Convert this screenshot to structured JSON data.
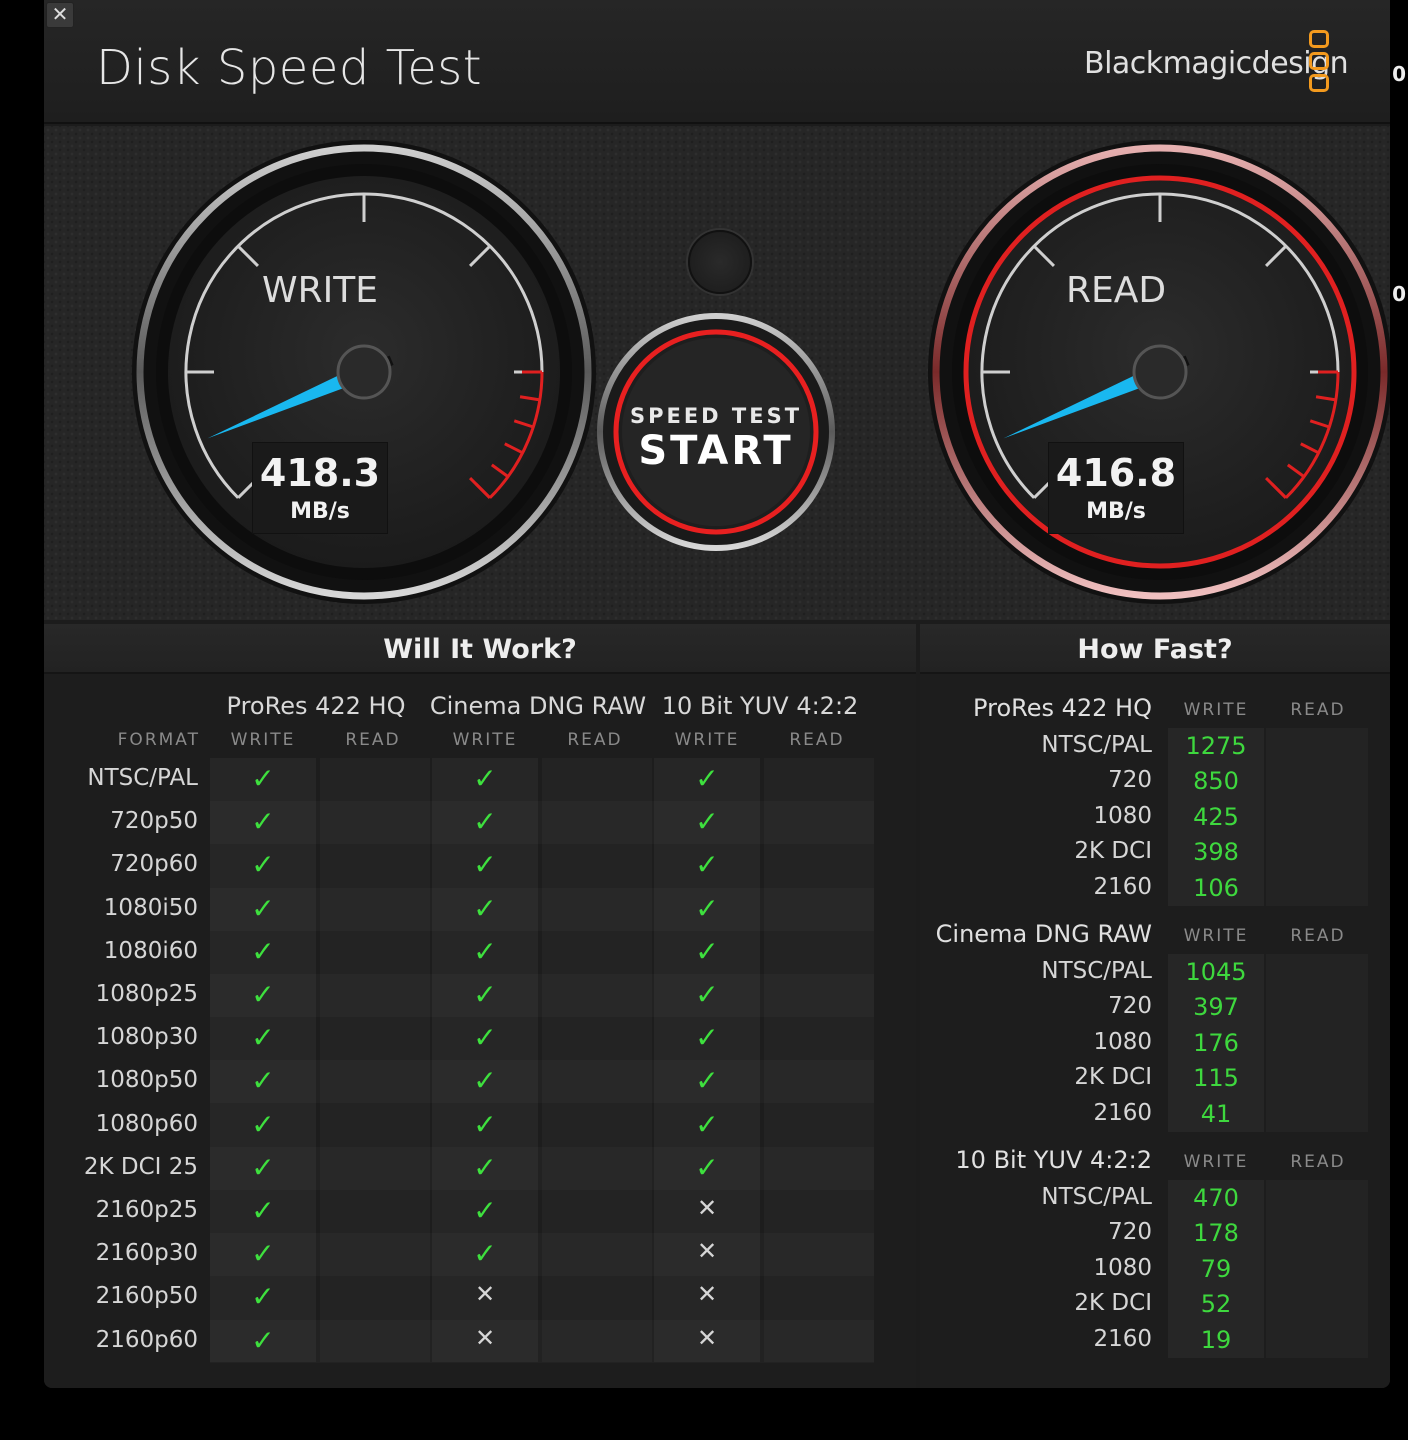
{
  "app": {
    "title": "Disk Speed Test",
    "brand": "Blackmagicdesign",
    "close": "✕",
    "edge_marks": [
      "0",
      "0"
    ]
  },
  "gauges": {
    "write": {
      "label": "WRITE",
      "value": "418.3",
      "unit": "MB/s"
    },
    "read": {
      "label": "READ",
      "value": "416.8",
      "unit": "MB/s"
    }
  },
  "start_button": {
    "sub": "SPEED TEST",
    "main": "START"
  },
  "will_it_work": {
    "title": "Will It Work?",
    "format_header": "FORMAT",
    "codecs": [
      "ProRes 422 HQ",
      "Cinema DNG RAW",
      "10 Bit YUV 4:2:2"
    ],
    "col_write": "WRITE",
    "col_read": "READ",
    "rows": [
      {
        "format": "NTSC/PAL",
        "marks": [
          "ok",
          "ok",
          "ok"
        ]
      },
      {
        "format": "720p50",
        "marks": [
          "ok",
          "ok",
          "ok"
        ]
      },
      {
        "format": "720p60",
        "marks": [
          "ok",
          "ok",
          "ok"
        ]
      },
      {
        "format": "1080i50",
        "marks": [
          "ok",
          "ok",
          "ok"
        ]
      },
      {
        "format": "1080i60",
        "marks": [
          "ok",
          "ok",
          "ok"
        ]
      },
      {
        "format": "1080p25",
        "marks": [
          "ok",
          "ok",
          "ok"
        ]
      },
      {
        "format": "1080p30",
        "marks": [
          "ok",
          "ok",
          "ok"
        ]
      },
      {
        "format": "1080p50",
        "marks": [
          "ok",
          "ok",
          "ok"
        ]
      },
      {
        "format": "1080p60",
        "marks": [
          "ok",
          "ok",
          "ok"
        ]
      },
      {
        "format": "2K DCI 25",
        "marks": [
          "ok",
          "ok",
          "ok"
        ]
      },
      {
        "format": "2160p25",
        "marks": [
          "ok",
          "ok",
          "no"
        ]
      },
      {
        "format": "2160p30",
        "marks": [
          "ok",
          "ok",
          "no"
        ]
      },
      {
        "format": "2160p50",
        "marks": [
          "ok",
          "no",
          "no"
        ]
      },
      {
        "format": "2160p60",
        "marks": [
          "ok",
          "no",
          "no"
        ]
      }
    ]
  },
  "how_fast": {
    "title": "How Fast?",
    "col_write": "WRITE",
    "col_read": "READ",
    "groups": [
      {
        "codec": "ProRes 422 HQ",
        "rows": [
          {
            "format": "NTSC/PAL",
            "write": "1275"
          },
          {
            "format": "720",
            "write": "850"
          },
          {
            "format": "1080",
            "write": "425"
          },
          {
            "format": "2K DCI",
            "write": "398"
          },
          {
            "format": "2160",
            "write": "106"
          }
        ]
      },
      {
        "codec": "Cinema DNG RAW",
        "rows": [
          {
            "format": "NTSC/PAL",
            "write": "1045"
          },
          {
            "format": "720",
            "write": "397"
          },
          {
            "format": "1080",
            "write": "176"
          },
          {
            "format": "2K DCI",
            "write": "115"
          },
          {
            "format": "2160",
            "write": "41"
          }
        ]
      },
      {
        "codec": "10 Bit YUV 4:2:2",
        "rows": [
          {
            "format": "NTSC/PAL",
            "write": "470"
          },
          {
            "format": "720",
            "write": "178"
          },
          {
            "format": "1080",
            "write": "79"
          },
          {
            "format": "2K DCI",
            "write": "52"
          },
          {
            "format": "2160",
            "write": "19"
          }
        ]
      }
    ]
  },
  "colors": {
    "ok": "#3ee03e",
    "needle": "#19b8f0",
    "red": "#e02020",
    "accent": "#f39a1e"
  },
  "icons": {
    "check": "✓",
    "cross": "✕",
    "settings": "gear-icon"
  }
}
